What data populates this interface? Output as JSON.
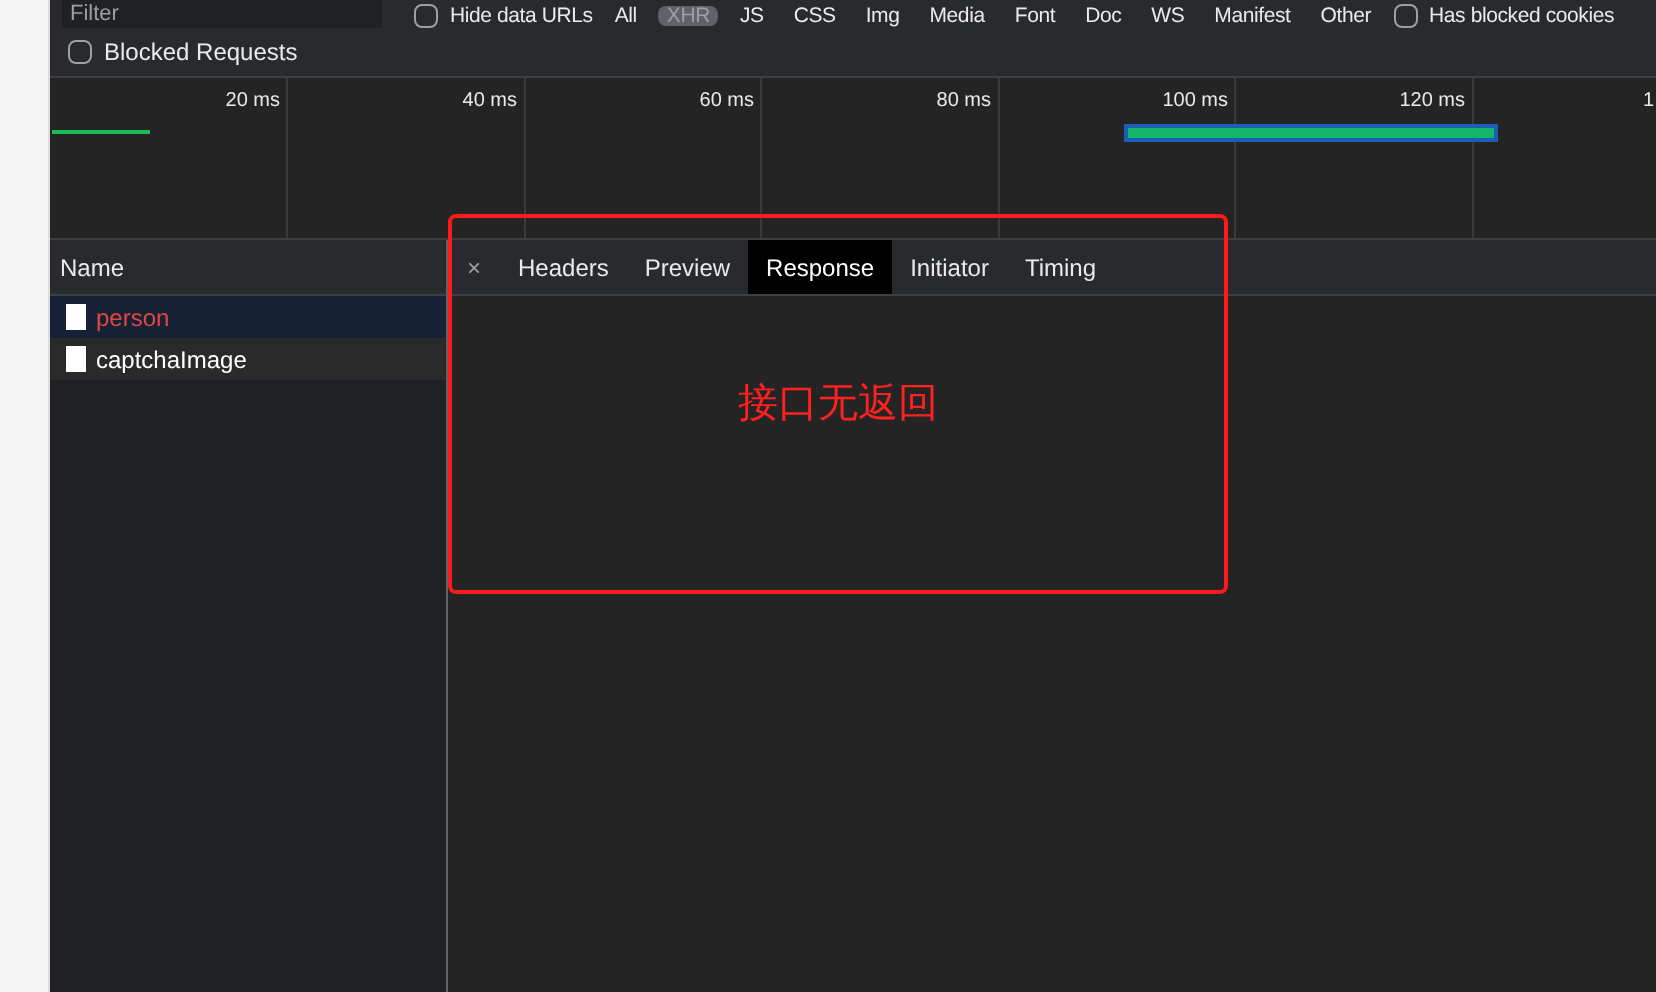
{
  "toolbar": {
    "filter": {
      "placeholder": "Filter"
    },
    "hide_data_urls": {
      "label": "Hide data URLs",
      "checked": false
    },
    "types": [
      {
        "label": "All",
        "selected": false
      },
      {
        "label": "XHR",
        "selected": true
      },
      {
        "label": "JS",
        "selected": false
      },
      {
        "label": "CSS",
        "selected": false
      },
      {
        "label": "Img",
        "selected": false
      },
      {
        "label": "Media",
        "selected": false
      },
      {
        "label": "Font",
        "selected": false
      },
      {
        "label": "Doc",
        "selected": false
      },
      {
        "label": "WS",
        "selected": false
      },
      {
        "label": "Manifest",
        "selected": false
      },
      {
        "label": "Other",
        "selected": false
      }
    ],
    "has_blocked_cookies": {
      "label": "Has blocked cookies",
      "checked": false
    },
    "blocked_requests": {
      "label": "Blocked Requests",
      "checked": false
    }
  },
  "timeline": {
    "ticks": [
      "20 ms",
      "40 ms",
      "60 ms",
      "80 ms",
      "100 ms",
      "120 ms",
      "1"
    ]
  },
  "requests": {
    "column": "Name",
    "rows": [
      {
        "name": "person",
        "selected": true,
        "error": true
      },
      {
        "name": "captchaImage",
        "selected": false,
        "error": false
      }
    ]
  },
  "details": {
    "tabs": [
      {
        "label": "Headers",
        "selected": false
      },
      {
        "label": "Preview",
        "selected": false
      },
      {
        "label": "Response",
        "selected": true
      },
      {
        "label": "Initiator",
        "selected": false
      },
      {
        "label": "Timing",
        "selected": false
      }
    ],
    "close": "×"
  },
  "annotation": {
    "text": "接口无返回"
  }
}
